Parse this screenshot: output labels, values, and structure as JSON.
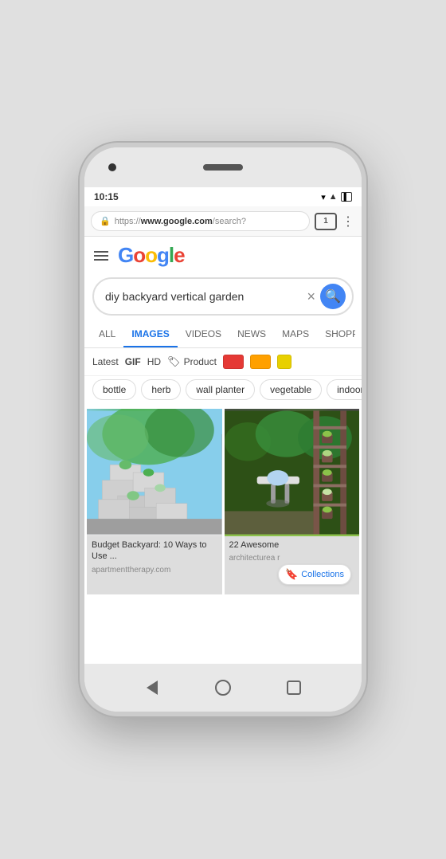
{
  "phone": {
    "status": {
      "time": "10:15",
      "wifi": "▲▼",
      "signal": "▲",
      "battery": "▐"
    },
    "browser": {
      "url_prefix": "https://",
      "url_domain": "www.google.com",
      "url_path": "/search?",
      "tab_count": "1"
    },
    "nav": {
      "back_label": "◀",
      "home_label": "○",
      "recent_label": "□"
    }
  },
  "google": {
    "logo": {
      "G": "G",
      "o1": "o",
      "o2": "o",
      "g": "g",
      "l": "l",
      "e": "e"
    },
    "search": {
      "query": "diy backyard vertical garden",
      "clear_label": "×",
      "search_label": "🔍"
    },
    "tabs": [
      {
        "label": "ALL",
        "active": false
      },
      {
        "label": "IMAGES",
        "active": true
      },
      {
        "label": "VIDEOS",
        "active": false
      },
      {
        "label": "NEWS",
        "active": false
      },
      {
        "label": "MAPS",
        "active": false
      },
      {
        "label": "SHOPPING",
        "active": false
      }
    ],
    "filters": {
      "latest": "Latest",
      "gif": "GIF",
      "hd": "HD",
      "product_label": "Product",
      "color1": "#E53935",
      "color2": "#FFA000",
      "color3": "#E8E000"
    },
    "pills": [
      "bottle",
      "herb",
      "wall planter",
      "vegetable",
      "indoor"
    ],
    "images": [
      {
        "caption": "Budget Backyard: 10 Ways to Use ...",
        "source": "apartmenttherapy.com",
        "alt": "Garden image 1"
      },
      {
        "caption": "22 Awesome",
        "source": "architecturea r",
        "collections_label": "Collections",
        "alt": "Garden image 2"
      }
    ]
  }
}
